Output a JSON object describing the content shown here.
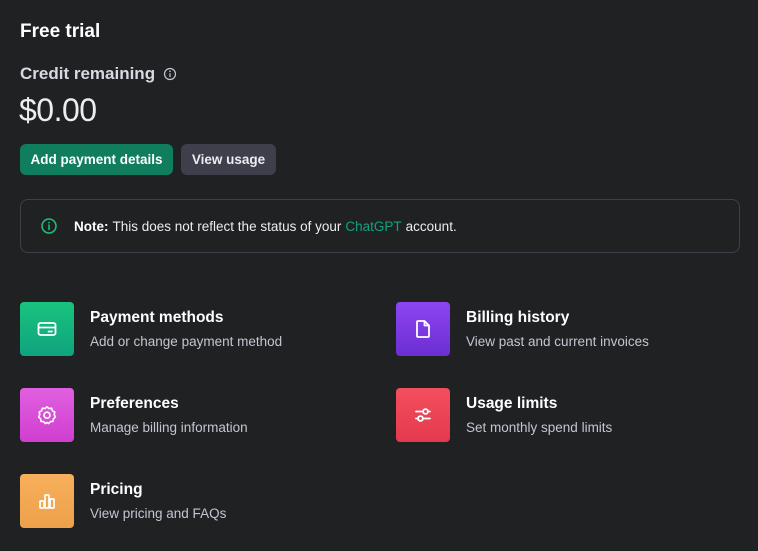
{
  "plan": {
    "title": "Free trial"
  },
  "credit": {
    "label": "Credit remaining",
    "amount": "$0.00"
  },
  "actions": {
    "primary_label": "Add payment details",
    "secondary_label": "View usage"
  },
  "note": {
    "bold": "Note:",
    "text_before": "This does not reflect the status of your",
    "link": "ChatGPT",
    "text_after": "account."
  },
  "cards": [
    {
      "title": "Payment methods",
      "description": "Add or change payment method",
      "icon": "credit-card-icon",
      "color": "#19c37d"
    },
    {
      "title": "Billing history",
      "description": "View past and current invoices",
      "icon": "document-icon",
      "color": "#8e44f4"
    },
    {
      "title": "Preferences",
      "description": "Manage billing information",
      "icon": "gear-icon",
      "color": "#d03fd0"
    },
    {
      "title": "Usage limits",
      "description": "Set monthly spend limits",
      "icon": "sliders-icon",
      "color": "#f24f5e"
    },
    {
      "title": "Pricing",
      "description": "View pricing and FAQs",
      "icon": "bar-chart-icon",
      "color": "#f7b05b"
    }
  ],
  "colors": {
    "background": "#202123",
    "accent": "#10a37f",
    "primary_button": "#0f7d5e"
  }
}
